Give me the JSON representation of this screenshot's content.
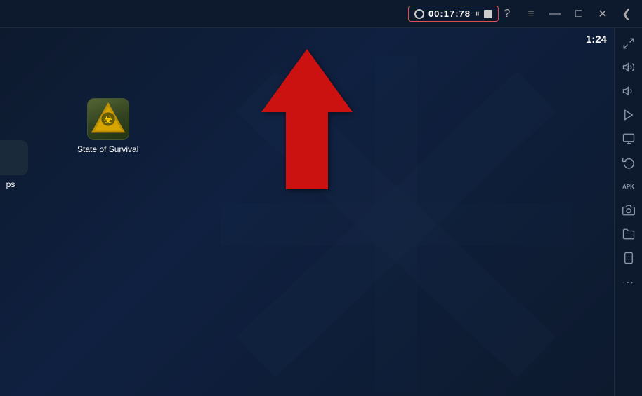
{
  "titlebar": {
    "timer": "00:17:78",
    "time_label": "1:24",
    "help_label": "?",
    "menu_label": "≡",
    "minimize_label": "—",
    "maximize_label": "□",
    "close_label": "✕",
    "back_label": "❮"
  },
  "app_icon": {
    "label": "State of Survival",
    "partial_label": "ps"
  },
  "sidebar": {
    "buttons": [
      {
        "name": "expand-icon",
        "symbol": "⤢"
      },
      {
        "name": "volume-up-icon",
        "symbol": "🔊"
      },
      {
        "name": "volume-down-icon",
        "symbol": "🔉"
      },
      {
        "name": "play-icon",
        "symbol": "▶"
      },
      {
        "name": "screen-icon",
        "symbol": "🖥"
      },
      {
        "name": "rotate-icon",
        "symbol": "↺"
      },
      {
        "name": "install-apk-icon",
        "symbol": "APK"
      },
      {
        "name": "camera-icon",
        "symbol": "📷"
      },
      {
        "name": "folder-icon",
        "symbol": "📁"
      },
      {
        "name": "phone-icon",
        "symbol": "📱"
      },
      {
        "name": "more-icon",
        "symbol": "•••"
      }
    ]
  }
}
